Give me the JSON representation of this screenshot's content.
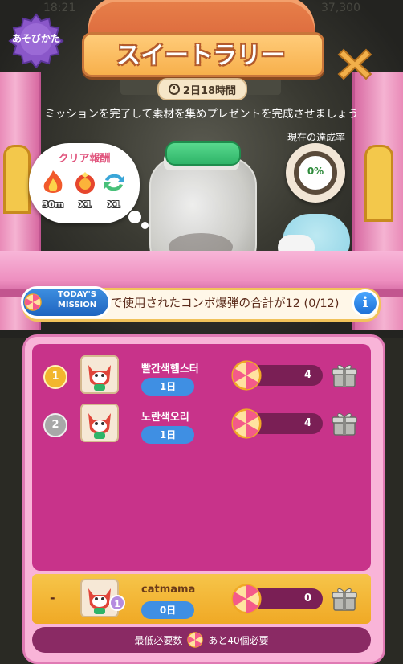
{
  "status_bar": {
    "left": "18:21",
    "right": "37,300"
  },
  "howto": {
    "label": "あそびかた"
  },
  "title": "スイートラリー",
  "timer": "2日18時間",
  "description": "ミッションを完了して素材を集めプレゼントを完成させましょう",
  "reward": {
    "title": "クリア報酬",
    "items": [
      {
        "icon": "fire-boost-icon",
        "value": "30m"
      },
      {
        "icon": "bomb-icon",
        "value": "X1"
      },
      {
        "icon": "shuffle-icon",
        "value": "X1"
      }
    ]
  },
  "progress": {
    "label": "現在の達成率",
    "value": "0%",
    "fraction": 0
  },
  "mission": {
    "badge_line1": "TODAY'S",
    "badge_line2": "MISSION",
    "text": "で使用されたコンボ爆弾の合計が12 (0/12)"
  },
  "ranking": [
    {
      "rank": "1",
      "name": "빨간색햄스터",
      "day": "1日",
      "score": "4"
    },
    {
      "rank": "2",
      "name": "노란색오리",
      "day": "1日",
      "score": "4"
    }
  ],
  "me": {
    "rank": "-",
    "name": "catmama",
    "day": "0日",
    "score": "0",
    "level": "1"
  },
  "footer": {
    "label": "最低必要数",
    "remaining": "あと40個必要"
  },
  "colors": {
    "panel": "#c8338a",
    "accent_blue": "#3f8fe3",
    "gold": "#f0a925"
  }
}
